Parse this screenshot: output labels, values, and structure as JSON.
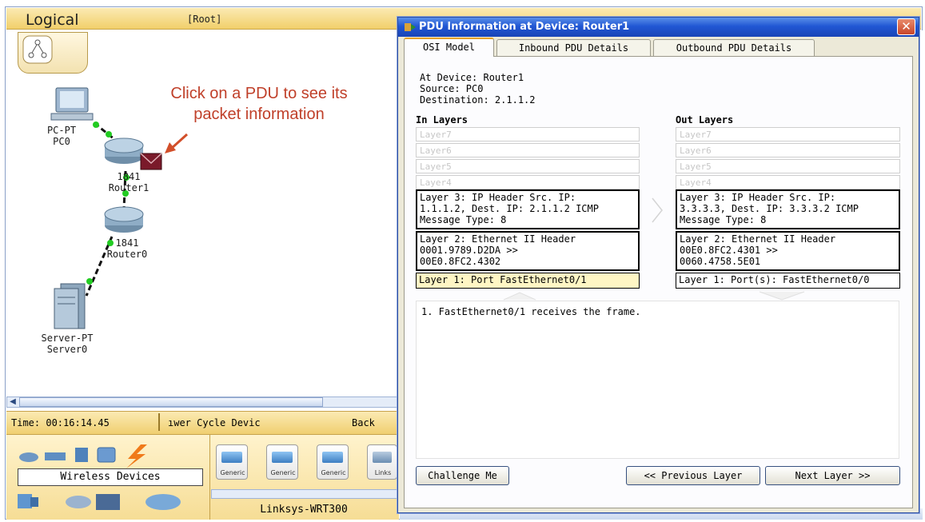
{
  "header": {
    "mode_label": "Logical",
    "path_label": "[Root]"
  },
  "canvas": {
    "annotation_line1": "Click on a PDU to see its",
    "annotation_line2": "packet information",
    "devices": [
      {
        "type_label": "PC-PT",
        "name_label": "PC0"
      },
      {
        "type_label": "1841",
        "name_label": "Router1"
      },
      {
        "type_label": "1841",
        "name_label": "Router0"
      },
      {
        "type_label": "Server-PT",
        "name_label": "Server0"
      }
    ]
  },
  "statusbar": {
    "time_label": "Time: 00:16:14.45",
    "power_label": "ıwer Cycle Devic",
    "back_label": "Back"
  },
  "palette": {
    "category_label": "Wireless Devices",
    "device_buttons": [
      "Generic",
      "Generic",
      "Generic",
      "Links"
    ],
    "selected_device_label": "Linksys-WRT300"
  },
  "dialog": {
    "title": "PDU Information at Device: Router1",
    "close_glyph": "✕",
    "tabs": [
      {
        "label": "OSI Model",
        "active": true
      },
      {
        "label": "Inbound PDU Details",
        "active": false
      },
      {
        "label": "Outbound PDU Details",
        "active": false
      }
    ],
    "at_device": "At Device: Router1",
    "source": "Source: PC0",
    "destination": "Destination: 2.1.1.2",
    "in_layers_heading": "In Layers",
    "out_layers_heading": "Out Layers",
    "in_layers": {
      "dim": [
        "Layer7",
        "Layer6",
        "Layer5",
        "Layer4"
      ],
      "layer3": [
        "Layer 3: IP Header Src. IP:",
        "1.1.1.2, Dest. IP: 2.1.1.2 ICMP",
        "Message Type: 8"
      ],
      "layer2": [
        "Layer 2: Ethernet II Header",
        "0001.9789.D2DA >>",
        "00E0.8FC2.4302"
      ],
      "layer1": "Layer 1: Port FastEthernet0/1"
    },
    "out_layers": {
      "dim": [
        "Layer7",
        "Layer6",
        "Layer5",
        "Layer4"
      ],
      "layer3": [
        "Layer 3: IP Header Src. IP:",
        "3.3.3.3, Dest. IP: 3.3.3.2 ICMP",
        "Message Type: 8"
      ],
      "layer2": [
        "Layer 2: Ethernet II Header",
        "00E0.8FC2.4301 >>",
        "0060.4758.5E01"
      ],
      "layer1": "Layer 1: Port(s): FastEthernet0/0"
    },
    "description": "1. FastEthernet0/1 receives the frame.",
    "buttons": {
      "challenge": "Challenge Me",
      "previous": "<< Previous Layer",
      "next": "Next Layer >>"
    }
  },
  "colors": {
    "title_bar": "#2157d4",
    "annotation": "#c0402a",
    "link_green": "#22cc22",
    "pdu_envelope": "#7a1a2a",
    "selected_layer": "#fff6c4"
  },
  "icons": [
    "topology-icon",
    "pc-icon",
    "router-icon",
    "server-icon",
    "pdu-envelope-icon",
    "close-icon",
    "arrow-icon"
  ]
}
